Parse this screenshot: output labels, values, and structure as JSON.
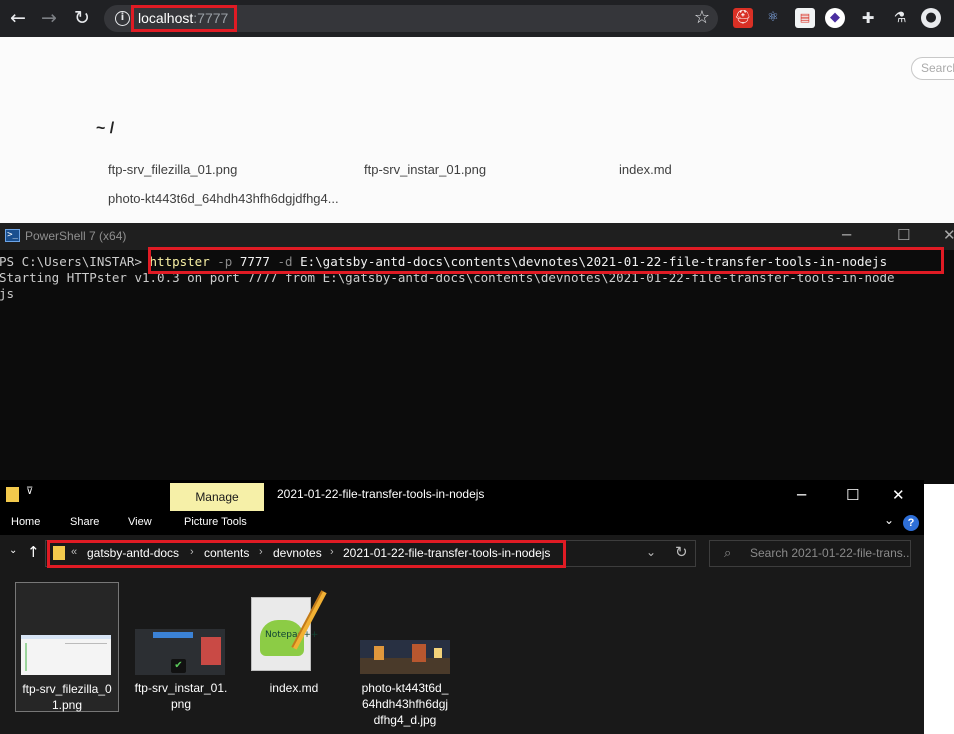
{
  "browser": {
    "url_host": "localhost",
    "url_port": ":7777",
    "icons": [
      "back-icon",
      "forward-icon",
      "reload-icon",
      "info-icon",
      "star-icon",
      "extensions-icon",
      "profile-icon"
    ]
  },
  "webpage": {
    "search_placeholder": "Search",
    "breadcrumb": "~ /",
    "files": [
      "ftp-srv_filezilla_01.png",
      "ftp-srv_instar_01.png",
      "index.md",
      "photo-kt443t6d_64hdh43hfh6dgjdfhg4..."
    ]
  },
  "powershell": {
    "title": "PowerShell 7 (x64)",
    "prompt": "PS C:\\Users\\INSTAR> ",
    "cmd_name": "httpster",
    "cmd_flag_p": "-p",
    "cmd_port": "7777",
    "cmd_flag_d": "-d",
    "cmd_path": "E:\\gatsby-antd-docs\\contents\\devnotes\\2021-01-22-file-transfer-tools-in-nodejs",
    "output_line1": "Starting HTTPster v1.0.3 on port 7777 from E:\\gatsby-antd-docs\\contents\\devnotes\\2021-01-22-file-transfer-tools-in-node",
    "output_line2": "js"
  },
  "explorer": {
    "manage_tab": "Manage",
    "title": "2021-01-22-file-transfer-tools-in-nodejs",
    "ribbon_tabs": [
      "Home",
      "Share",
      "View",
      "Picture Tools"
    ],
    "path": [
      "gatsby-antd-docs",
      "contents",
      "devnotes",
      "2021-01-22-file-transfer-tools-in-nodejs"
    ],
    "search_placeholder": "Search 2021-01-22-file-trans...",
    "files": [
      {
        "label": "ftp-srv_filezilla_0\n1.png",
        "icon": "image-thumbnail"
      },
      {
        "label": "ftp-srv_instar_01.\npng",
        "icon": "image-thumbnail"
      },
      {
        "label": "index.md",
        "icon": "notepad-plus-plus-icon"
      },
      {
        "label": "photo-kt443t6d_\n64hdh43hfh6dgj\ndfhg4_d.jpg",
        "icon": "image-thumbnail"
      }
    ]
  },
  "colors": {
    "highlight": "#e01b24",
    "chrome_bg": "#202124",
    "terminal_bg": "#0c0c0c",
    "manage_tab": "#f6f0a8"
  }
}
